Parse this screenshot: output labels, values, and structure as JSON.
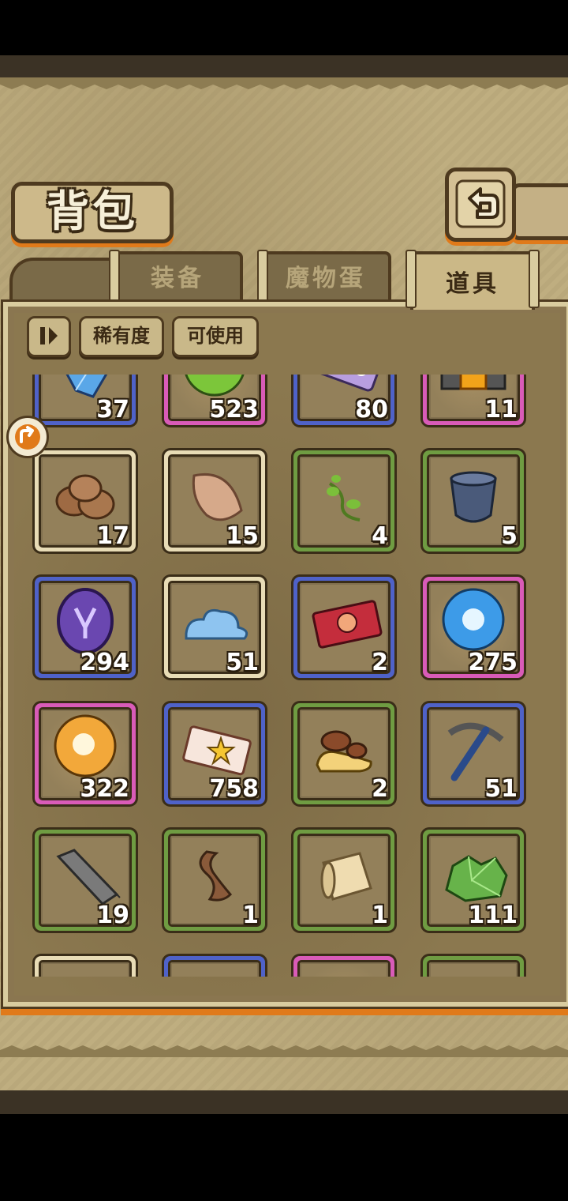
{
  "title": "背包",
  "tabs": [
    {
      "label": "装备",
      "active": false
    },
    {
      "label": "魔物蛋",
      "active": false
    },
    {
      "label": "道具",
      "active": true
    }
  ],
  "filters": {
    "sort_icon": "sort-toggle-icon",
    "rarity_label": "稀有度",
    "usable_label": "可使用"
  },
  "colors": {
    "rarity_white": "#e8dcb6",
    "rarity_green": "#6f9c42",
    "rarity_blue": "#4f62c8",
    "rarity_pink": "#d95bb8",
    "accent_orange": "#e07a1a"
  },
  "items": [
    {
      "icon": "blue-crystal-icon",
      "rarity": "blue",
      "count": "37"
    },
    {
      "icon": "green-orb-icon",
      "rarity": "pink",
      "count": "523"
    },
    {
      "icon": "purple-ticket-icon",
      "rarity": "blue",
      "count": "80"
    },
    {
      "icon": "lantern-machine-icon",
      "rarity": "pink",
      "count": "11"
    },
    {
      "icon": "wool-yarn-icon",
      "rarity": "white",
      "count": "17"
    },
    {
      "icon": "feather-leaf-icon",
      "rarity": "white",
      "count": "15"
    },
    {
      "icon": "vine-sprout-icon",
      "rarity": "green",
      "count": "4"
    },
    {
      "icon": "stone-vase-icon",
      "rarity": "green",
      "count": "5"
    },
    {
      "icon": "purple-rune-coin-icon",
      "rarity": "blue",
      "count": "294"
    },
    {
      "icon": "blue-slime-cloud-icon",
      "rarity": "white",
      "count": "51"
    },
    {
      "icon": "red-summon-ticket-icon",
      "rarity": "blue",
      "count": "2"
    },
    {
      "icon": "blue-orb-icon",
      "rarity": "pink",
      "count": "275"
    },
    {
      "icon": "orange-orb-icon",
      "rarity": "pink",
      "count": "322"
    },
    {
      "icon": "star-ticket-icon",
      "rarity": "blue",
      "count": "758"
    },
    {
      "icon": "mushroom-icon",
      "rarity": "green",
      "count": "2"
    },
    {
      "icon": "pickaxe-icon",
      "rarity": "blue",
      "count": "51"
    },
    {
      "icon": "iron-ingot-icon",
      "rarity": "green",
      "count": "19"
    },
    {
      "icon": "brown-hair-icon",
      "rarity": "green",
      "count": "1"
    },
    {
      "icon": "cloth-scroll-icon",
      "rarity": "green",
      "count": "1"
    },
    {
      "icon": "green-ore-icon",
      "rarity": "green",
      "count": "111"
    },
    {
      "icon": "partial-item-icon",
      "rarity": "white",
      "count": ""
    },
    {
      "icon": "partial-item-icon",
      "rarity": "blue",
      "count": ""
    },
    {
      "icon": "partial-item-icon",
      "rarity": "pink",
      "count": ""
    },
    {
      "icon": "partial-item-icon",
      "rarity": "green",
      "count": ""
    }
  ]
}
